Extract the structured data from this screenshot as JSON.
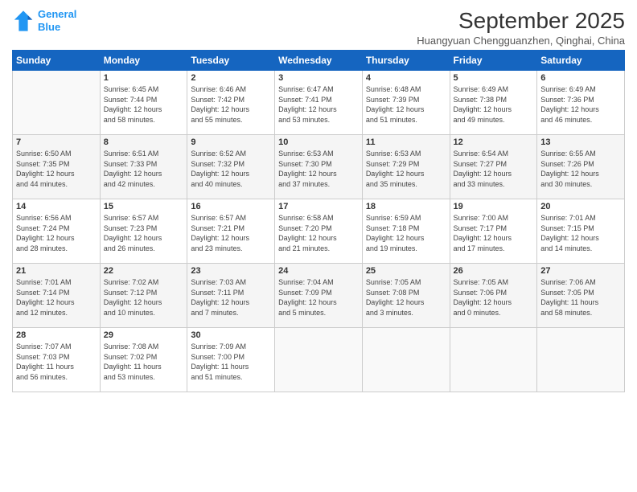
{
  "logo": {
    "line1": "General",
    "line2": "Blue"
  },
  "title": "September 2025",
  "subtitle": "Huangyuan Chengguanzhen, Qinghai, China",
  "days_of_week": [
    "Sunday",
    "Monday",
    "Tuesday",
    "Wednesday",
    "Thursday",
    "Friday",
    "Saturday"
  ],
  "weeks": [
    [
      {
        "num": "",
        "info": ""
      },
      {
        "num": "1",
        "info": "Sunrise: 6:45 AM\nSunset: 7:44 PM\nDaylight: 12 hours\nand 58 minutes."
      },
      {
        "num": "2",
        "info": "Sunrise: 6:46 AM\nSunset: 7:42 PM\nDaylight: 12 hours\nand 55 minutes."
      },
      {
        "num": "3",
        "info": "Sunrise: 6:47 AM\nSunset: 7:41 PM\nDaylight: 12 hours\nand 53 minutes."
      },
      {
        "num": "4",
        "info": "Sunrise: 6:48 AM\nSunset: 7:39 PM\nDaylight: 12 hours\nand 51 minutes."
      },
      {
        "num": "5",
        "info": "Sunrise: 6:49 AM\nSunset: 7:38 PM\nDaylight: 12 hours\nand 49 minutes."
      },
      {
        "num": "6",
        "info": "Sunrise: 6:49 AM\nSunset: 7:36 PM\nDaylight: 12 hours\nand 46 minutes."
      }
    ],
    [
      {
        "num": "7",
        "info": "Sunrise: 6:50 AM\nSunset: 7:35 PM\nDaylight: 12 hours\nand 44 minutes."
      },
      {
        "num": "8",
        "info": "Sunrise: 6:51 AM\nSunset: 7:33 PM\nDaylight: 12 hours\nand 42 minutes."
      },
      {
        "num": "9",
        "info": "Sunrise: 6:52 AM\nSunset: 7:32 PM\nDaylight: 12 hours\nand 40 minutes."
      },
      {
        "num": "10",
        "info": "Sunrise: 6:53 AM\nSunset: 7:30 PM\nDaylight: 12 hours\nand 37 minutes."
      },
      {
        "num": "11",
        "info": "Sunrise: 6:53 AM\nSunset: 7:29 PM\nDaylight: 12 hours\nand 35 minutes."
      },
      {
        "num": "12",
        "info": "Sunrise: 6:54 AM\nSunset: 7:27 PM\nDaylight: 12 hours\nand 33 minutes."
      },
      {
        "num": "13",
        "info": "Sunrise: 6:55 AM\nSunset: 7:26 PM\nDaylight: 12 hours\nand 30 minutes."
      }
    ],
    [
      {
        "num": "14",
        "info": "Sunrise: 6:56 AM\nSunset: 7:24 PM\nDaylight: 12 hours\nand 28 minutes."
      },
      {
        "num": "15",
        "info": "Sunrise: 6:57 AM\nSunset: 7:23 PM\nDaylight: 12 hours\nand 26 minutes."
      },
      {
        "num": "16",
        "info": "Sunrise: 6:57 AM\nSunset: 7:21 PM\nDaylight: 12 hours\nand 23 minutes."
      },
      {
        "num": "17",
        "info": "Sunrise: 6:58 AM\nSunset: 7:20 PM\nDaylight: 12 hours\nand 21 minutes."
      },
      {
        "num": "18",
        "info": "Sunrise: 6:59 AM\nSunset: 7:18 PM\nDaylight: 12 hours\nand 19 minutes."
      },
      {
        "num": "19",
        "info": "Sunrise: 7:00 AM\nSunset: 7:17 PM\nDaylight: 12 hours\nand 17 minutes."
      },
      {
        "num": "20",
        "info": "Sunrise: 7:01 AM\nSunset: 7:15 PM\nDaylight: 12 hours\nand 14 minutes."
      }
    ],
    [
      {
        "num": "21",
        "info": "Sunrise: 7:01 AM\nSunset: 7:14 PM\nDaylight: 12 hours\nand 12 minutes."
      },
      {
        "num": "22",
        "info": "Sunrise: 7:02 AM\nSunset: 7:12 PM\nDaylight: 12 hours\nand 10 minutes."
      },
      {
        "num": "23",
        "info": "Sunrise: 7:03 AM\nSunset: 7:11 PM\nDaylight: 12 hours\nand 7 minutes."
      },
      {
        "num": "24",
        "info": "Sunrise: 7:04 AM\nSunset: 7:09 PM\nDaylight: 12 hours\nand 5 minutes."
      },
      {
        "num": "25",
        "info": "Sunrise: 7:05 AM\nSunset: 7:08 PM\nDaylight: 12 hours\nand 3 minutes."
      },
      {
        "num": "26",
        "info": "Sunrise: 7:05 AM\nSunset: 7:06 PM\nDaylight: 12 hours\nand 0 minutes."
      },
      {
        "num": "27",
        "info": "Sunrise: 7:06 AM\nSunset: 7:05 PM\nDaylight: 11 hours\nand 58 minutes."
      }
    ],
    [
      {
        "num": "28",
        "info": "Sunrise: 7:07 AM\nSunset: 7:03 PM\nDaylight: 11 hours\nand 56 minutes."
      },
      {
        "num": "29",
        "info": "Sunrise: 7:08 AM\nSunset: 7:02 PM\nDaylight: 11 hours\nand 53 minutes."
      },
      {
        "num": "30",
        "info": "Sunrise: 7:09 AM\nSunset: 7:00 PM\nDaylight: 11 hours\nand 51 minutes."
      },
      {
        "num": "",
        "info": ""
      },
      {
        "num": "",
        "info": ""
      },
      {
        "num": "",
        "info": ""
      },
      {
        "num": "",
        "info": ""
      }
    ]
  ]
}
